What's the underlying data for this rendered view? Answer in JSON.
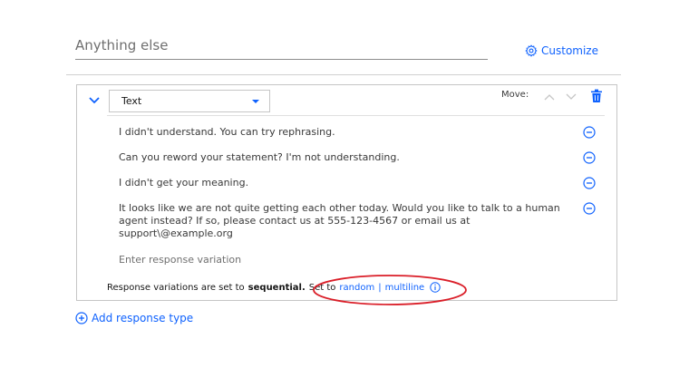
{
  "header": {
    "title": "Anything else",
    "customize_label": "Customize"
  },
  "response": {
    "type_select": {
      "value": "Text"
    },
    "move_label": "Move:",
    "variations": [
      "I didn't understand. You can try rephrasing.",
      "Can you reword your statement? I'm not understanding.",
      "I didn't get your meaning.",
      "It looks like we are not quite getting each other today. Would you like to talk to a human agent instead? If so, please contact us at 555-123-4567 or email us at support\\@example.org"
    ],
    "new_variation_placeholder": "Enter response variation",
    "footer": {
      "prefix": "Response variations are set to",
      "mode": "sequential.",
      "set_to": "Set to",
      "option_random": "random",
      "separator": "|",
      "option_multiline": "multiline"
    }
  },
  "add_response_type_label": "Add response type",
  "icons": {
    "customize": "gear-icon",
    "collapse": "chevron-down-icon",
    "move_up": "chevron-up-icon",
    "move_down": "chevron-down-icon",
    "delete": "trash-icon",
    "remove_variation": "minus-circle-icon",
    "info": "info-icon",
    "add": "plus-circle-icon"
  },
  "colors": {
    "accent": "#0f62fe",
    "annotation": "#da1e28",
    "border": "#c6c6c6"
  }
}
